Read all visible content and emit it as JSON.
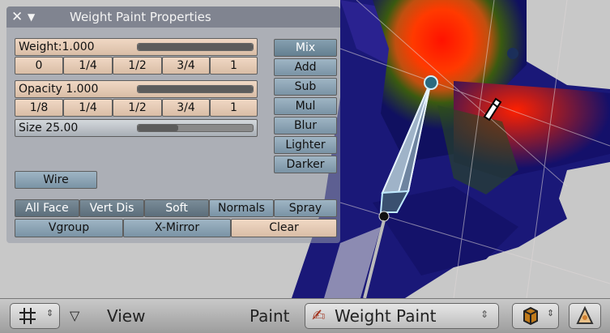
{
  "panel": {
    "title": "Weight Paint Properties",
    "weight_label": "Weight:1.000",
    "weight_fraction": 1.0,
    "weight_presets": [
      "0",
      "1/4",
      "1/2",
      "3/4",
      "1"
    ],
    "opacity_label": "Opacity 1.000",
    "opacity_fraction": 1.0,
    "opacity_presets": [
      "1/8",
      "1/4",
      "1/2",
      "3/4",
      "1"
    ],
    "size_label": "Size 25.00",
    "size_fraction": 0.35,
    "wire_label": "Wire",
    "modes": [
      "Mix",
      "Add",
      "Sub",
      "Mul",
      "Blur",
      "Lighter",
      "Darker"
    ],
    "active_mode": "Mix",
    "toggles": [
      "All Face",
      "Vert Dis",
      "Soft",
      "Normals",
      "Spray"
    ],
    "bottom_row": [
      "Vgroup",
      "X-Mirror",
      "Clear"
    ]
  },
  "header": {
    "view_label": "View",
    "paint_label": "Paint",
    "mode_select": "Weight Paint",
    "icons": [
      "grid-icon",
      "triangle-down-icon",
      "paint-brush-icon",
      "shaded-cube-icon",
      "edit-triangle-icon"
    ]
  },
  "colors": {
    "tan": "#e6cab4",
    "panel": "#969ba8",
    "mesh_blue": "#10106a",
    "hot_red": "#ff1a00"
  }
}
